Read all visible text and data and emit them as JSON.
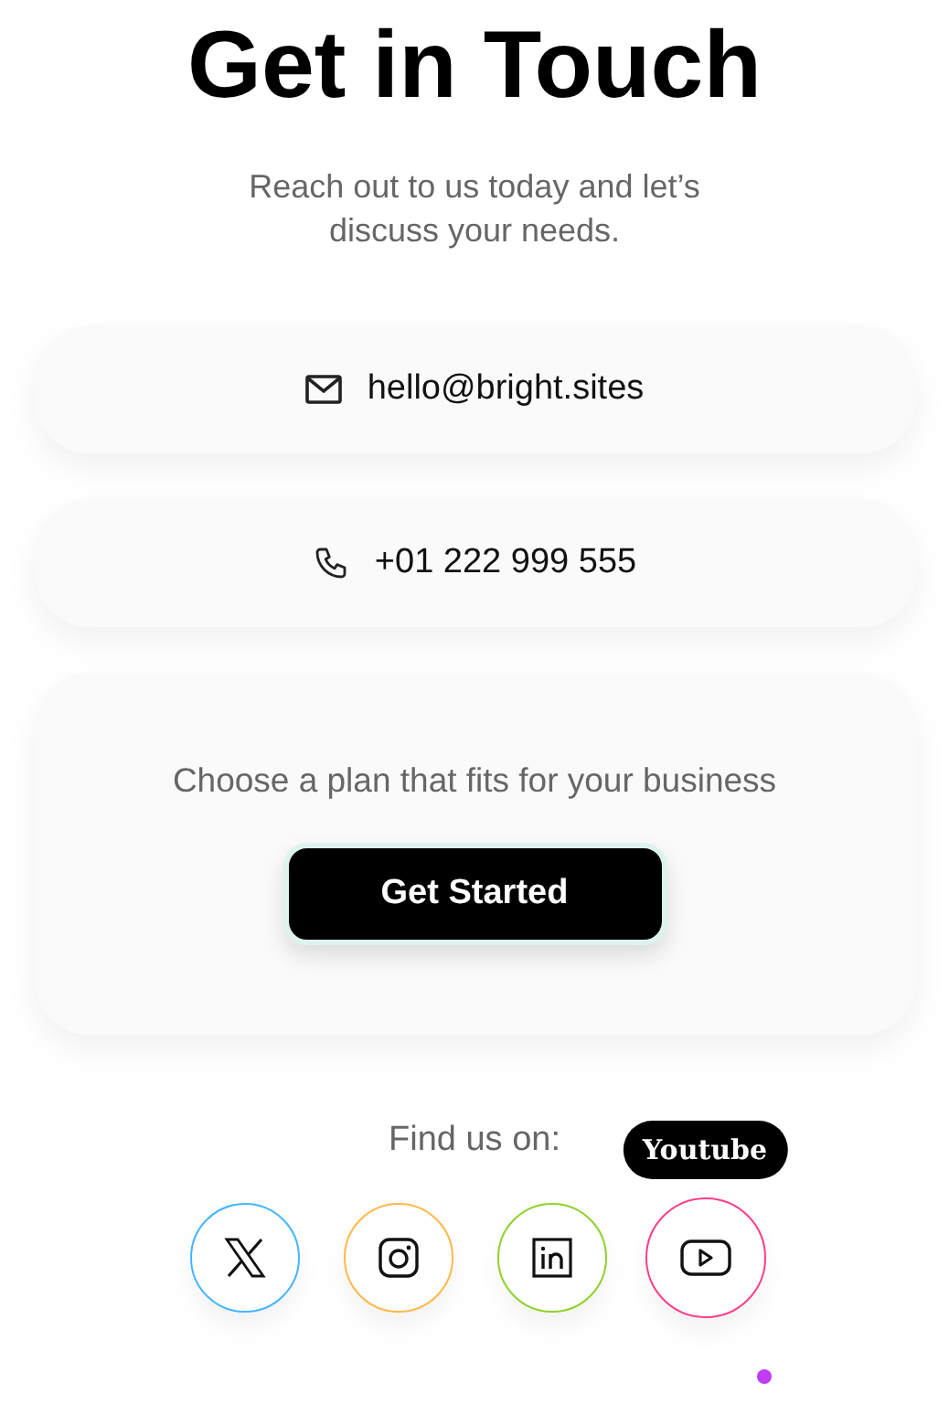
{
  "title": "Get in Touch",
  "subtitle": "Reach out to us today and let’s discuss your needs.",
  "contacts": [
    {
      "kind": "email",
      "text": "hello@bright.sites"
    },
    {
      "kind": "phone",
      "text": "+01 222 999 555"
    }
  ],
  "plan": {
    "text": "Choose a plan that fits for your business",
    "button": "Get Started"
  },
  "socials_label": "Find us on:",
  "socials": [
    {
      "kind": "x",
      "color": "#45b5ff",
      "hovered": false
    },
    {
      "kind": "instagram",
      "color": "#ffb84a",
      "hovered": false
    },
    {
      "kind": "linkedin",
      "color": "#8ed22a",
      "hovered": false
    },
    {
      "kind": "youtube",
      "color": "#ff3d8b",
      "hovered": true,
      "tooltip": "Youtube"
    }
  ]
}
